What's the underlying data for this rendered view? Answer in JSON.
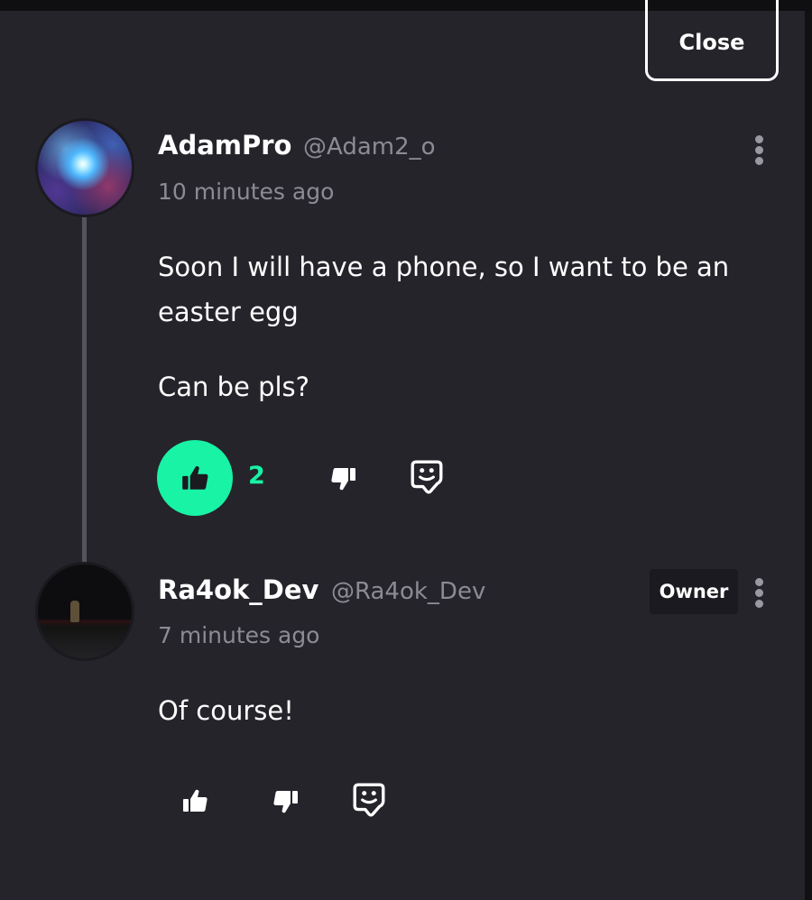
{
  "header": {
    "close_label": "Close"
  },
  "comments": [
    {
      "author": "AdamPro",
      "handle": "@Adam2_o",
      "time": "10 minutes ago",
      "paragraphs": [
        "Soon I will have a phone, so I want to be an easter egg",
        "Can be pls?"
      ],
      "likes": "2",
      "liked": true
    },
    {
      "author": "Ra4ok_Dev",
      "handle": "@Ra4ok_Dev",
      "badge": "Owner",
      "time": "7 minutes ago",
      "paragraphs": [
        "Of course!"
      ],
      "liked": false
    }
  ],
  "icons": {
    "like": "thumbs-up-icon",
    "dislike": "thumbs-down-icon",
    "reply": "reply-sticker-icon",
    "menu": "kebab-menu-icon"
  },
  "colors": {
    "background": "#25242b",
    "accent": "#18f3a6",
    "muted_text": "#8c8b93",
    "badge_bg": "#1b1a20"
  }
}
